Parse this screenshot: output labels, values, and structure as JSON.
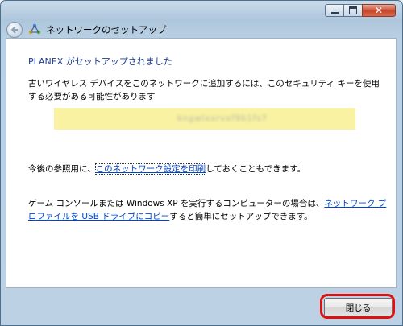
{
  "window": {
    "title": "ネットワークのセットアップ",
    "buttons": {
      "minimize": "minimize",
      "maximize": "maximize",
      "close": "close"
    }
  },
  "content": {
    "heading": "PLANEX がセットアップされました",
    "paragraph1": "古いワイヤレス デバイスをこのネットワークに追加するには、このセキュリティ キーを使用する必要がある可能性があります",
    "security_key": "kngwlxxrvxf9b1fs7",
    "paragraph2_before": "今後の参照用に、",
    "paragraph2_link": "このネットワーク設定を印刷",
    "paragraph2_after": "しておくこともできます。",
    "paragraph3_before": "ゲーム コンソールまたは Windows XP を実行するコンピューターの場合は、",
    "paragraph3_link": "ネットワーク プロファイルを USB ドライブにコピー",
    "paragraph3_after": "すると簡単にセットアップできます。"
  },
  "footer": {
    "close_label": "閉じる"
  },
  "colors": {
    "heading": "#1a3c8c",
    "link": "#0044cc",
    "key_background": "#f8f2a2",
    "highlight": "#e01010"
  },
  "icons": {
    "back": "back-arrow-icon",
    "network": "network-setup-icon"
  }
}
